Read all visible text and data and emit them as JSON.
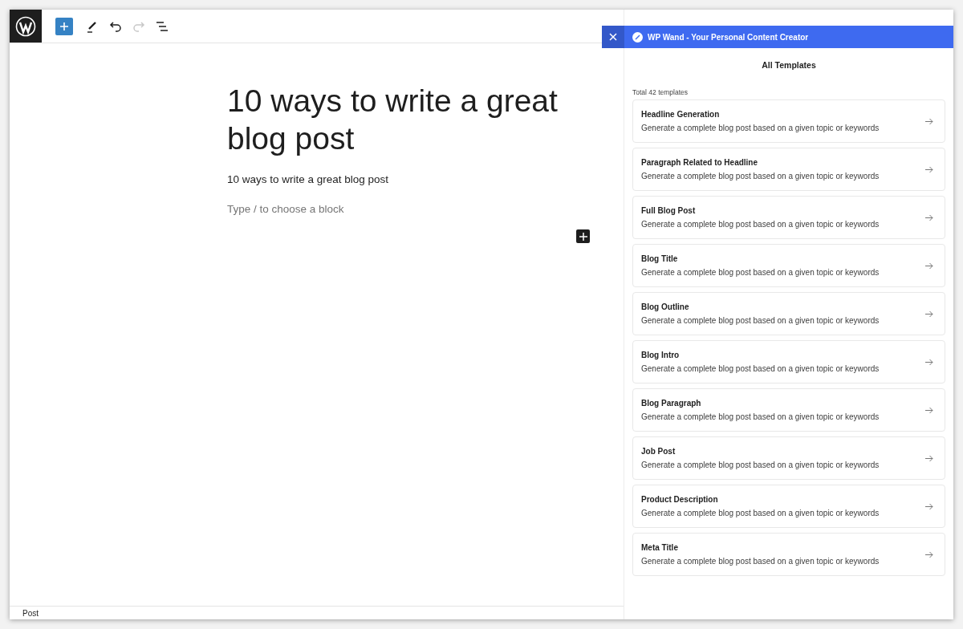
{
  "toolbar": {
    "undo": {
      "disabled": false
    },
    "redo": {
      "disabled": true
    }
  },
  "editor": {
    "title": "10 ways to write a great blog post",
    "paragraph": "10 ways to write a great blog post",
    "placeholder": "Type / to choose a block"
  },
  "status_bar": {
    "breadcrumb": "Post"
  },
  "sidebar": {
    "header": "WP Wand - Your Personal Content Creator",
    "heading": "All Templates",
    "count": "Total 42 templates",
    "templates": [
      {
        "title": "Headline Generation",
        "description": "Generate a complete blog post based on a given topic or keywords"
      },
      {
        "title": "Paragraph Related to Headline",
        "description": "Generate a complete blog post based on a given topic or keywords"
      },
      {
        "title": "Full Blog Post",
        "description": "Generate a complete blog post based on a given topic or keywords"
      },
      {
        "title": "Blog Title",
        "description": "Generate a complete blog post based on a given topic or keywords"
      },
      {
        "title": "Blog Outline",
        "description": "Generate a complete blog post based on a given topic or keywords"
      },
      {
        "title": "Blog Intro",
        "description": "Generate a complete blog post based on a given topic or keywords"
      },
      {
        "title": "Blog Paragraph",
        "description": "Generate a complete blog post based on a given topic or keywords"
      },
      {
        "title": "Job Post",
        "description": "Generate a complete blog post based on a given topic or keywords"
      },
      {
        "title": "Product Description",
        "description": "Generate a complete blog post based on a given topic or keywords"
      },
      {
        "title": "Meta Title",
        "description": "Generate a complete blog post based on a given topic or keywords"
      }
    ]
  }
}
